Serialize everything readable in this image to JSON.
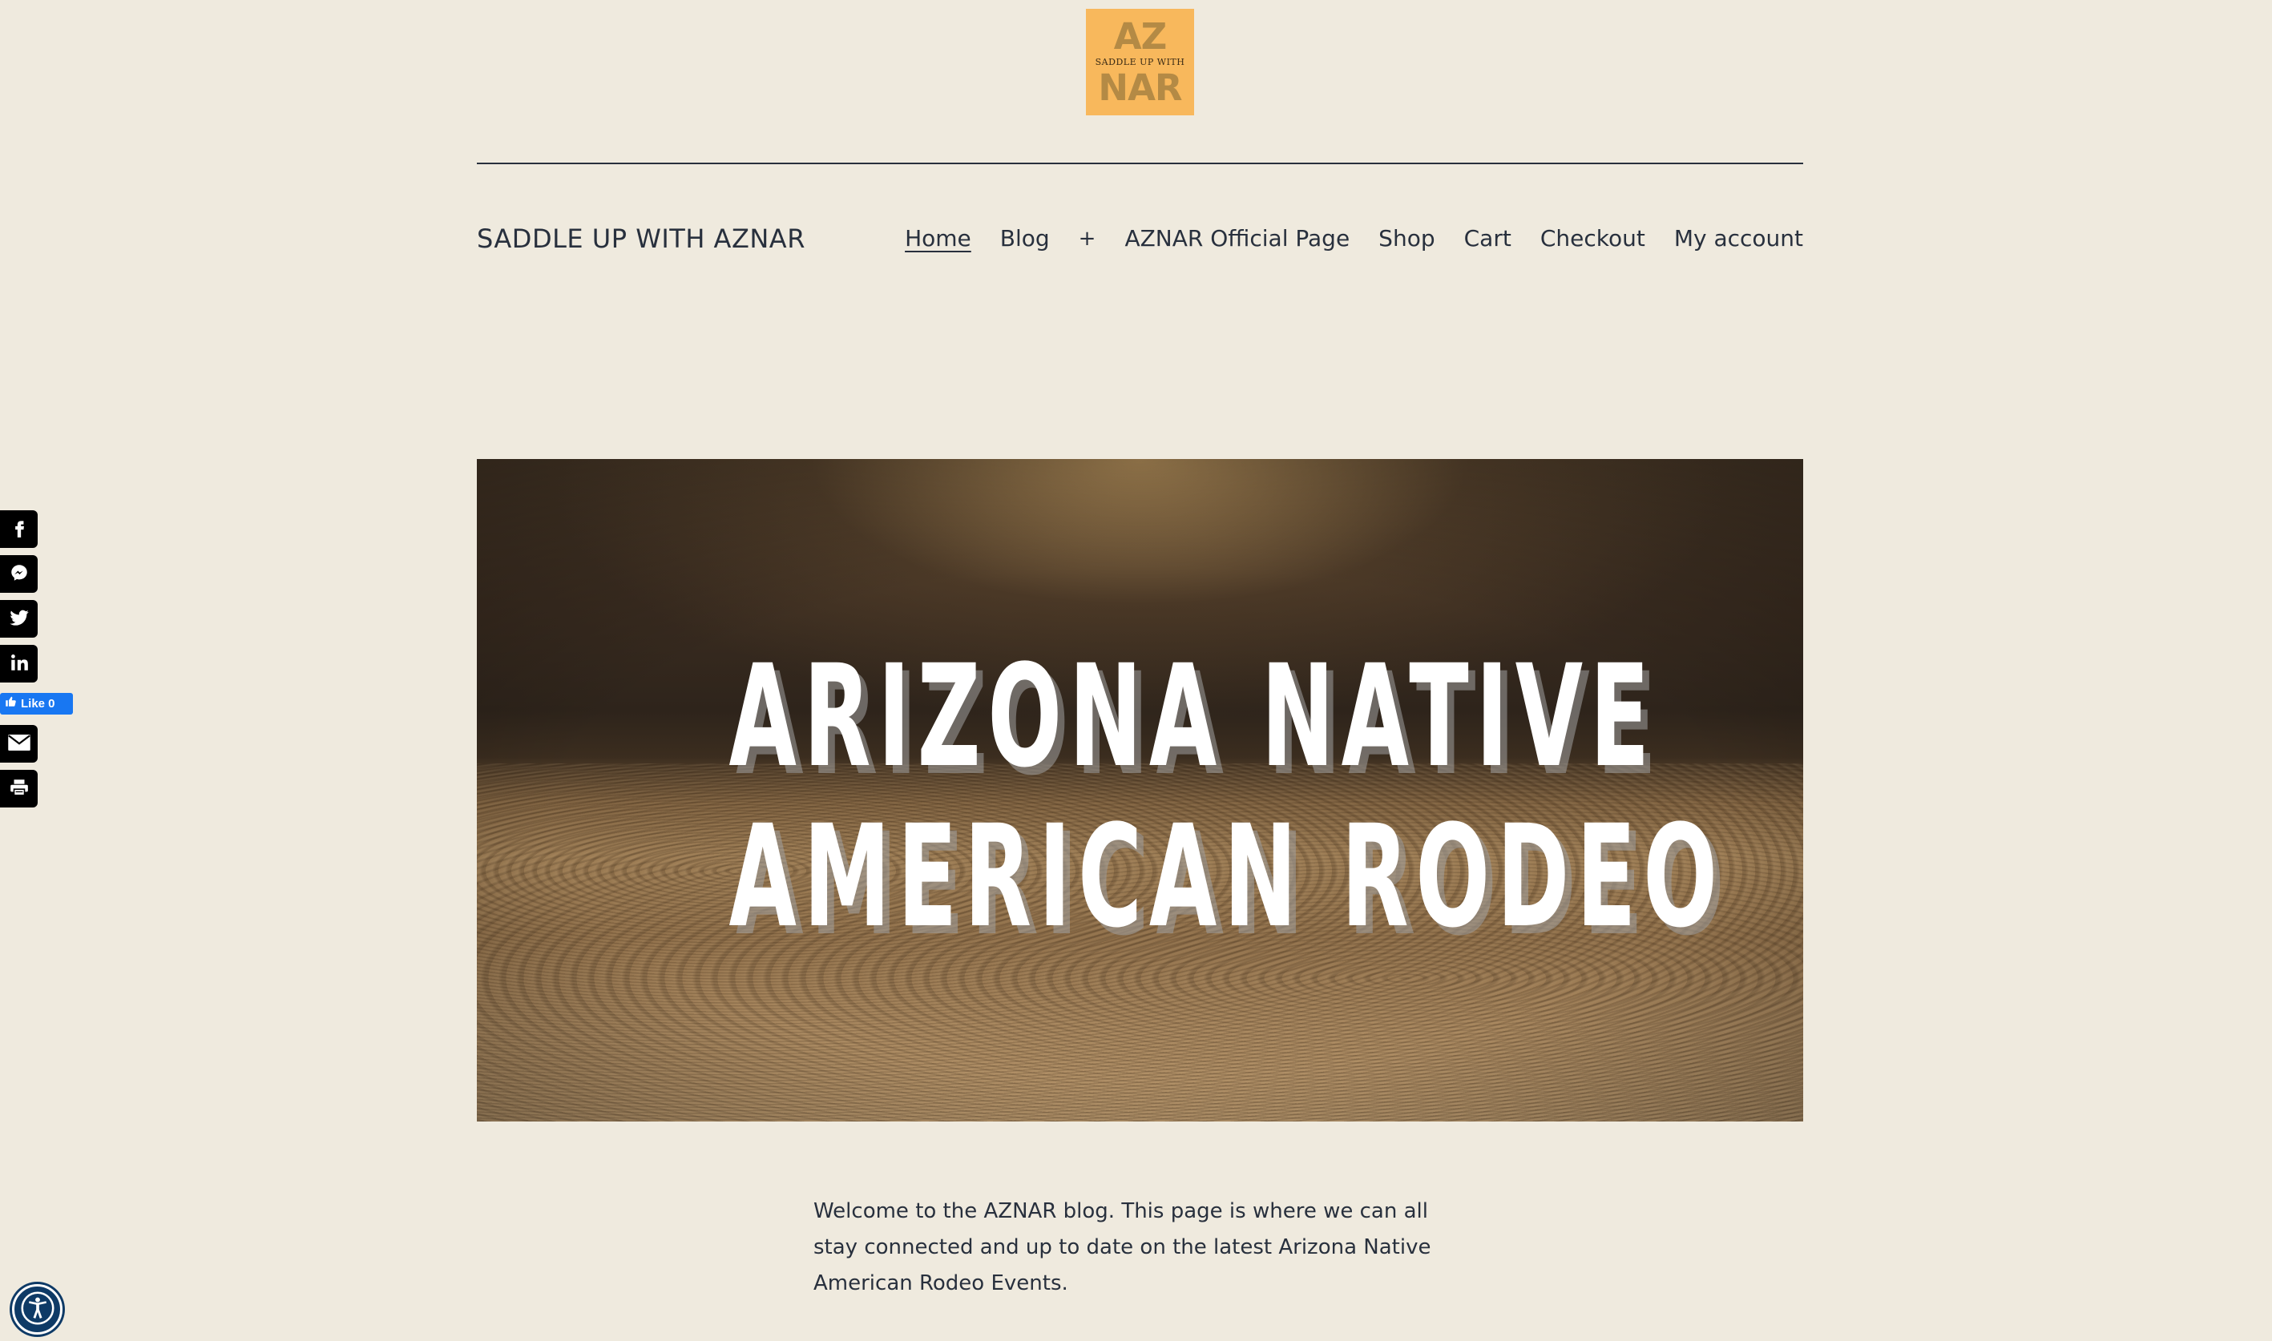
{
  "logo": {
    "line1": "AZ",
    "line2": "SADDLE UP WITH",
    "line3": "NAR",
    "bg_color": "#f8b85c"
  },
  "site": {
    "title": "SADDLE UP WITH AZNAR"
  },
  "nav": {
    "items": [
      {
        "label": "Home",
        "current": true
      },
      {
        "label": "Blog"
      },
      {
        "label": "+"
      },
      {
        "label": "AZNAR Official Page"
      },
      {
        "label": "Shop"
      },
      {
        "label": "Cart"
      },
      {
        "label": "Checkout"
      },
      {
        "label": "My account"
      }
    ]
  },
  "hero": {
    "line1": "ARIZONA NATIVE",
    "line2": "AMERICAN RODEO"
  },
  "content": {
    "welcome": "Welcome to the AZNAR blog. This page is where we can all stay connected and up to date on the latest Arizona Native American Rodeo Events."
  },
  "share": {
    "buttons": [
      "facebook-icon",
      "messenger-icon",
      "twitter-icon",
      "linkedin-icon",
      "email-icon",
      "print-icon"
    ],
    "like_label": "Like 0",
    "like_color": "#1877f2"
  },
  "accessibility": {
    "icon": "accessibility-icon",
    "color": "#0e3a66"
  }
}
